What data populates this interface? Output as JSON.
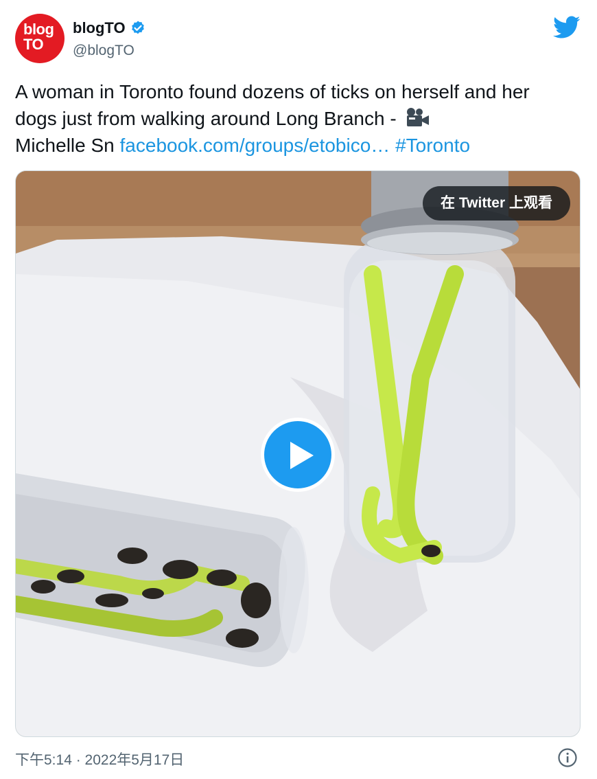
{
  "author": {
    "avatar_line1": "blog",
    "avatar_line2": "TO",
    "display_name": "blogTO",
    "handle": "@blogTO",
    "verified_icon": "verified-badge-icon"
  },
  "tweet": {
    "text_main": "A woman in Toronto found dozens of ticks on herself and her dogs just from walking around Long Branch - ",
    "camera_icon": "movie-camera-icon",
    "text_credit": "Michelle Sn ",
    "link_text": "facebook.com/groups/etobico…",
    "hashtag": "#Toronto",
    "timestamp": "下午5:14 · 2022年5月17日"
  },
  "media": {
    "watch_label": "在 Twitter 上观看",
    "play_icon": "play-icon"
  },
  "icons": {
    "brand": "twitter-bird-icon",
    "info": "info-icon"
  },
  "colors": {
    "link": "#1b95e0",
    "brand_blue": "#1d9bf0",
    "avatar_red": "#e31b23",
    "secondary_text": "#536471"
  }
}
